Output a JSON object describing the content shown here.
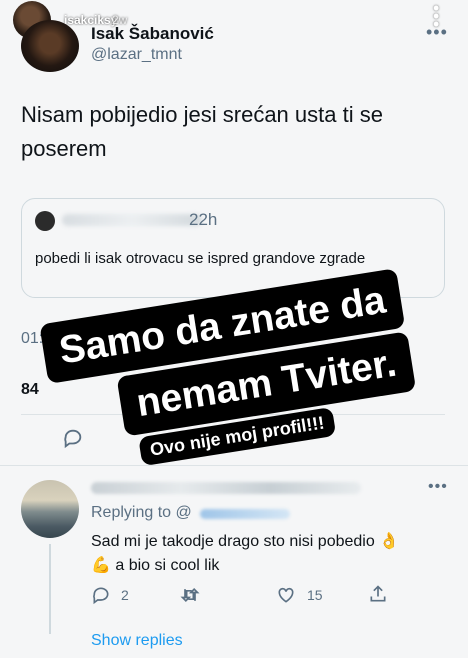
{
  "story": {
    "username": "isakciksy",
    "time": "2w",
    "more_icon": "vertical-dots-icon"
  },
  "tweet": {
    "name": "Isak Šabanović",
    "handle": "@lazar_tmnt",
    "text": "Nisam pobijedio jesi srećan usta ti se poserem",
    "more_icon": "horizontal-dots-icon",
    "timestamp": "01:20 · 27.06.2...",
    "stat_count": "84",
    "quoted": {
      "time": "22h",
      "text": "pobedi li isak otrovacu se ispred grandove zgrade"
    }
  },
  "reply": {
    "replying_to": "Replying to @",
    "text_line1": "Sad mi je takodje drago sto nisi pobedio 👌",
    "text_line2": "💪 a bio si cool lik",
    "reply_count": "2",
    "like_count": "15",
    "show_replies": "Show replies"
  },
  "sticker": {
    "line1": "Samo da znate da",
    "line2": "nemam Tviter.",
    "line3": "Ovo nije moj profil!!!"
  },
  "colors": {
    "background": "#f5f6f7",
    "link_blue": "#1d9bf0",
    "secondary_text": "#5b7083",
    "sticker_bg": "#000000"
  }
}
